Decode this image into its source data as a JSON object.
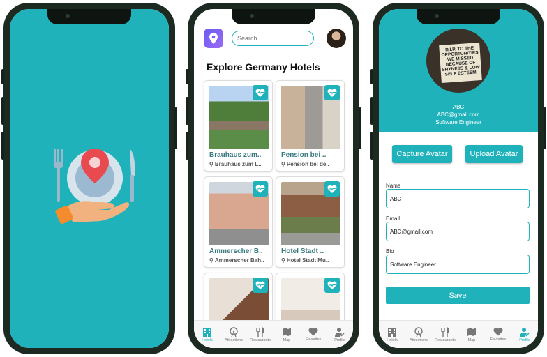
{
  "colors": {
    "accent": "#1fb2bb",
    "brand_icon": "#7b61ff",
    "tab_active": "#1fb2bb"
  },
  "explore": {
    "search_placeholder": "Search",
    "heading": "Explore Germany Hotels",
    "cards": [
      {
        "title": "Brauhaus zum..",
        "address": "Brauhaus zum L.."
      },
      {
        "title": "Pension bei ..",
        "address": "Pension bei de.."
      },
      {
        "title": "Ammerscher B..",
        "address": "Ammerscher Bah.."
      },
      {
        "title": "Hotel Stadt ..",
        "address": "Hotel Stadt Mu.."
      },
      {
        "title": "",
        "address": ""
      },
      {
        "title": "",
        "address": ""
      }
    ],
    "tabs": [
      "Hotels",
      "Attractions",
      "Restaurants",
      "Map",
      "Favorites",
      "Profile"
    ],
    "active_tab": "Hotels"
  },
  "profile": {
    "name": "ABC",
    "email": "ABC@gmail.com",
    "role": "Software Engineer",
    "photo_sign_text": "R.I.P. TO THE OPPORTUNITIES WE MISSED BECAUSE OF SHYNESS & LOW SELF ESTEEM.",
    "capture_label": "Capture Avatar",
    "upload_label": "Upload Avatar",
    "fields": {
      "name_label": "Name",
      "name_value": "ABC",
      "email_label": "Email",
      "email_value": "ABC@gmail.com",
      "bio_label": "Bio",
      "bio_value": "Software Engineer"
    },
    "save_label": "Save",
    "tabs": [
      "Hotels",
      "Attractions",
      "Restaurants",
      "Map",
      "Favorites",
      "Profile"
    ],
    "active_tab": "Profile"
  }
}
